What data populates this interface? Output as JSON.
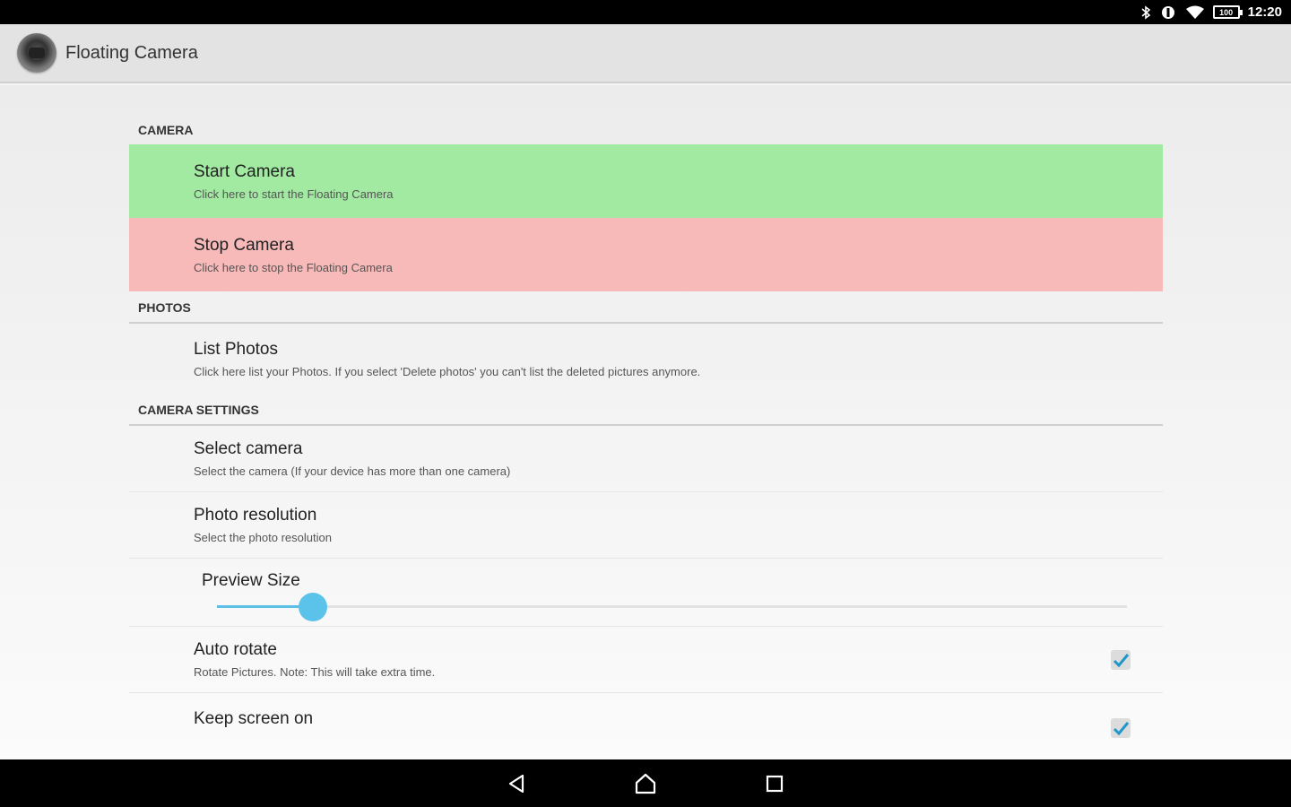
{
  "status_bar": {
    "icons": [
      "bluetooth-icon",
      "vibrate-icon",
      "wifi-icon",
      "battery-icon"
    ],
    "battery_level": "100",
    "time": "12:20"
  },
  "app_bar": {
    "icon": "camera-app-icon",
    "title": "Floating Camera"
  },
  "categories": {
    "camera": "CAMERA",
    "photos": "PHOTOS",
    "camera_settings": "CAMERA SETTINGS"
  },
  "prefs": {
    "start_camera": {
      "title": "Start Camera",
      "summary": "Click here to start the Floating Camera",
      "color": "#a2e9a2"
    },
    "stop_camera": {
      "title": "Stop Camera",
      "summary": "Click here to stop the Floating Camera",
      "color": "#f8b9b9"
    },
    "list_photos": {
      "title": "List Photos",
      "summary": "Click here list your Photos. If you select 'Delete photos' you can't list the deleted pictures anymore."
    },
    "select_camera": {
      "title": "Select camera",
      "summary": "Select the camera (If your device has more than one camera)"
    },
    "photo_resolution": {
      "title": "Photo resolution",
      "summary": "Select the photo resolution"
    },
    "preview_size": {
      "title": "Preview Size",
      "value_fraction": 0.105
    },
    "auto_rotate": {
      "title": "Auto rotate",
      "summary": "Rotate Pictures. Note: This will take extra time.",
      "checked": true
    },
    "keep_screen_on": {
      "title": "Keep screen on",
      "summary": "",
      "checked": true
    }
  },
  "colors": {
    "accent": "#5bc3ea",
    "check": "#2196c9"
  },
  "nav_bar": {
    "icons": [
      "back-icon",
      "home-icon",
      "recents-icon"
    ]
  }
}
